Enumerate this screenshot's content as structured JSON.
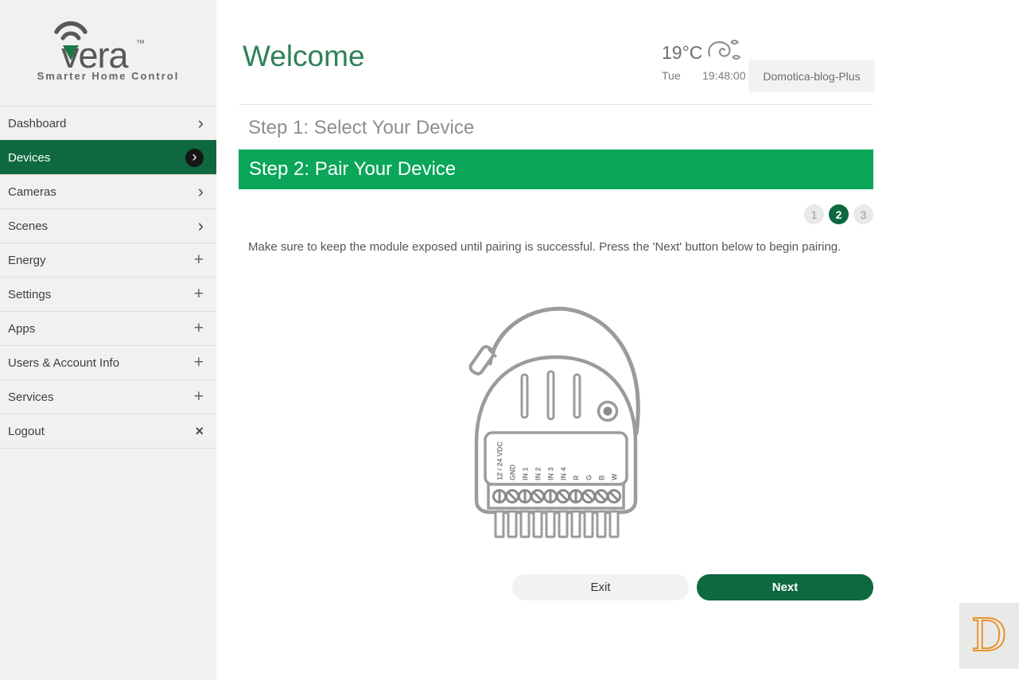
{
  "app": {
    "name": "vera",
    "trademark": "™",
    "tagline": "Smarter Home Control"
  },
  "colors": {
    "brand_green": "#1c7a45",
    "banner_green": "#0aa65a",
    "dark_green": "#0e6940",
    "title_green": "#2f8158",
    "watermark_orange": "#e8932c"
  },
  "sidebar": {
    "icons": {
      "chevron": "›",
      "plus": "+",
      "close": "×"
    },
    "items": [
      {
        "label": "Dashboard",
        "icon": "chevron-right"
      },
      {
        "label": "Devices",
        "icon": "chevron-right-circle",
        "selected": true
      },
      {
        "label": "Cameras",
        "icon": "chevron-right"
      },
      {
        "label": "Scenes",
        "icon": "chevron-right"
      },
      {
        "label": "Energy",
        "icon": "plus"
      },
      {
        "label": "Settings",
        "icon": "plus"
      },
      {
        "label": "Apps",
        "icon": "plus"
      },
      {
        "label": "Users & Account Info",
        "icon": "plus"
      },
      {
        "label": "Services",
        "icon": "plus"
      },
      {
        "label": "Logout",
        "icon": "close"
      }
    ]
  },
  "header": {
    "title": "Welcome",
    "weather": {
      "temperature": "19°C",
      "icon": "wind-swirl-icon"
    },
    "day": "Tue",
    "time": "19:48:00",
    "controller_name": "Domotica-blog-Plus"
  },
  "wizard": {
    "step1_title": "Step 1: Select Your Device",
    "step2_title": "Step 2: Pair Your Device",
    "pagination": [
      "1",
      "2",
      "3"
    ],
    "active_page": "2",
    "instruction": "Make sure to keep the module exposed until pairing is successful. Press the 'Next' button below to begin pairing.",
    "exit_label": "Exit",
    "next_label": "Next"
  },
  "device": {
    "terminals": [
      "12 / 24 VDC",
      "GND",
      "IN 1",
      "IN 2",
      "IN 3",
      "IN 4",
      "R",
      "G",
      "B",
      "W"
    ]
  },
  "watermark": {
    "letter": "D"
  }
}
